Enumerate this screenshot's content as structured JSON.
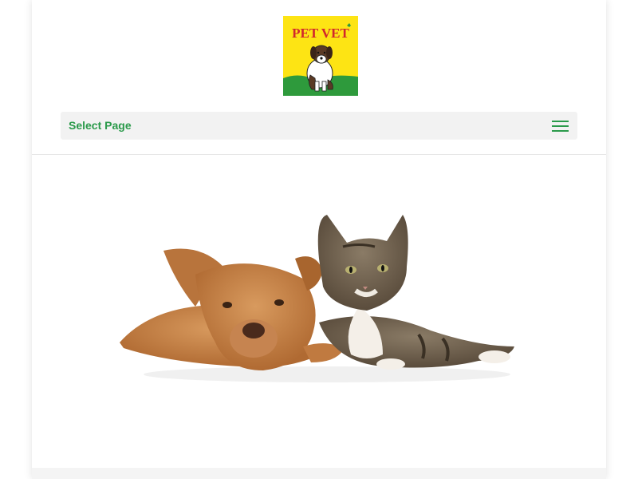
{
  "logo": {
    "text": "PET VET",
    "colors": {
      "background": "#fde414",
      "text": "#d1262d",
      "grass": "#2e9a3c"
    }
  },
  "nav": {
    "select_label": "Select Page",
    "menu_icon": "hamburger-menu-icon",
    "accent": "#2a9a4a"
  },
  "hero": {
    "image": "dog-and-cat-lying-together"
  }
}
